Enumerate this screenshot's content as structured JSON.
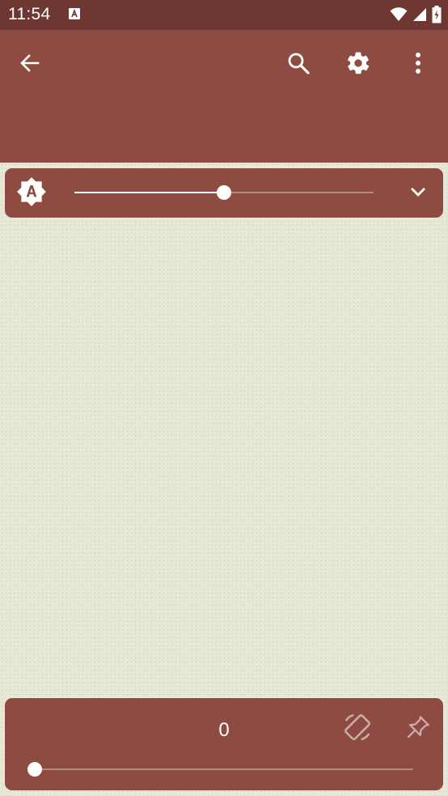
{
  "status_bar": {
    "time": "11:54",
    "icons": [
      "font-a-icon",
      "wifi-icon",
      "signal-icon",
      "battery-charging-icon"
    ]
  },
  "app_bar": {
    "background": "#8e4b41",
    "icons": [
      "back-arrow-icon",
      "search-icon",
      "gear-icon",
      "more-vert-icon"
    ]
  },
  "brightness": {
    "auto_icon": "brightness-auto-icon",
    "level_fraction": 0.5,
    "collapse_icon": "chevron-down-icon"
  },
  "bottom_panel": {
    "page_number": "0",
    "progress_fraction": 0.0,
    "icons": [
      "screen-rotation-icon",
      "pin-icon"
    ]
  },
  "colors": {
    "status_bar": "#6f3731",
    "accent": "#8e4b41",
    "paper": "#e8e8d9"
  }
}
